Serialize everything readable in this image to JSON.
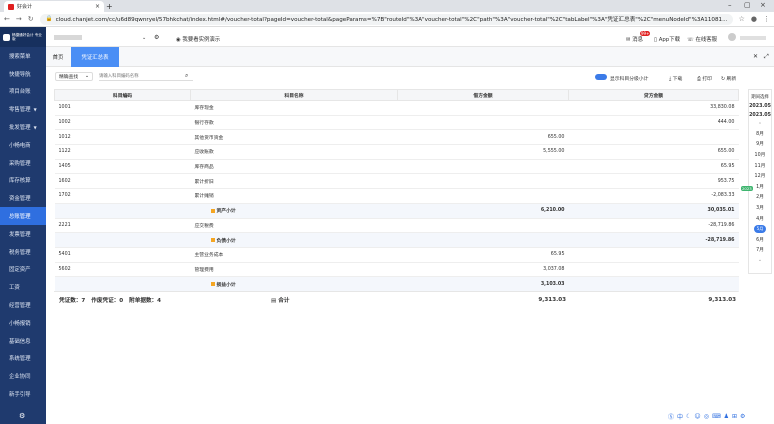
{
  "browser": {
    "tab_title": "好会计",
    "url": "cloud.chanjet.com/cc/u6d89qwnryel/57bhkchat/index.html#/voucher-total?pageId=voucher-total&pageParams=%7B\"routeId\"%3A\"voucher-total\"%2C\"path\"%3A\"voucher-total\"%2C\"tabLabel\"%3A\"凭证汇总表\"%2C\"menuNodeId\"%3A11081..."
  },
  "sidebar": {
    "logo": "畅捷通好会计 专业版",
    "items": [
      {
        "label": "搜索菜单"
      },
      {
        "label": "快捷导航"
      },
      {
        "label": "项目台账"
      },
      {
        "label": "零售管理",
        "arrow": "▼"
      },
      {
        "label": "批发管理",
        "arrow": "▼"
      },
      {
        "label": "小畅电商"
      },
      {
        "label": "采购管理"
      },
      {
        "label": "库存核算"
      },
      {
        "label": "资金管理"
      },
      {
        "label": "总账管理"
      },
      {
        "label": "发票管理"
      },
      {
        "label": "税务管理"
      },
      {
        "label": "固定资产"
      },
      {
        "label": "工资"
      },
      {
        "label": "经营管理"
      },
      {
        "label": "小畅报销"
      },
      {
        "label": "基础信息"
      },
      {
        "label": "系统管理"
      },
      {
        "label": "企业协同"
      },
      {
        "label": "新手引导"
      }
    ]
  },
  "header": {
    "demo_label": "我要看实例演示",
    "notice": "消息",
    "badge": "99+",
    "app_download": "App下载",
    "online_service": "在线客服"
  },
  "tabs": {
    "home": "首页",
    "current": "凭证汇总表"
  },
  "filter": {
    "type": "精确查找",
    "search_placeholder": "请输入科目编码名称",
    "show_level": "显示科目分级小计",
    "download": "下载",
    "print": "打印",
    "refresh": "刷新"
  },
  "table": {
    "headers": [
      "科目编码",
      "科目名称",
      "借方金额",
      "贷方金额"
    ],
    "rows": [
      {
        "code": "1001",
        "name": "库存现金",
        "debit": "",
        "credit": "33,830.08",
        "sub": false
      },
      {
        "code": "1002",
        "name": "银行存款",
        "debit": "",
        "credit": "444.00",
        "sub": false
      },
      {
        "code": "1012",
        "name": "其他货币资金",
        "debit": "655.00",
        "credit": "",
        "sub": false
      },
      {
        "code": "1122",
        "name": "应收账款",
        "debit": "5,555.00",
        "credit": "655.00",
        "sub": false
      },
      {
        "code": "1405",
        "name": "库存商品",
        "debit": "",
        "credit": "65.95",
        "sub": false
      },
      {
        "code": "1602",
        "name": "累计折旧",
        "debit": "",
        "credit": "953.75",
        "sub": false
      },
      {
        "code": "1702",
        "name": "累计摊销",
        "debit": "",
        "credit": "-2,083.33",
        "sub": false
      },
      {
        "code": "",
        "name": "资产小计",
        "debit": "6,210.00",
        "credit": "30,035.01",
        "sub": true
      },
      {
        "code": "2221",
        "name": "应交税费",
        "debit": "",
        "credit": "-28,719.86",
        "sub": false
      },
      {
        "code": "",
        "name": "负债小计",
        "debit": "",
        "credit": "-28,719.86",
        "sub": true
      },
      {
        "code": "5401",
        "name": "主营业务成本",
        "debit": "65.95",
        "credit": "",
        "sub": false
      },
      {
        "code": "5602",
        "name": "管理费用",
        "debit": "3,037.08",
        "credit": "",
        "sub": false
      },
      {
        "code": "",
        "name": "损益小计",
        "debit": "3,103.03",
        "credit": "",
        "sub": true
      }
    ]
  },
  "footer": {
    "vouchers": "凭证数：7",
    "void": "作废凭证：0",
    "attachments": "附单据数：4",
    "total_label": "合计",
    "total_debit": "9,313.03",
    "total_credit": "9,313.03"
  },
  "period": {
    "title": "期间选择",
    "year_from": "2023.05",
    "year_to": "2023.05",
    "months": [
      "8月",
      "9月",
      "10月",
      "11月",
      "12月",
      "1月",
      "2月",
      "3月",
      "4月",
      "5月",
      "6月",
      "7月"
    ],
    "selected_year_tag": "2023",
    "selected": "5月"
  },
  "colors": {
    "sidebar": "#1f3a6e",
    "accent": "#2f6fe0"
  }
}
